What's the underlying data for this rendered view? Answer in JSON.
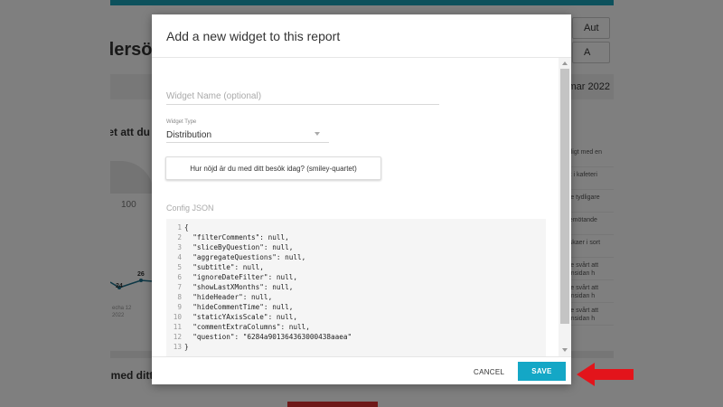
{
  "background": {
    "page_title": "dersö",
    "buttons": [
      "Aut",
      "A"
    ],
    "date_text": "mar 2022",
    "section_1_title": "det att du",
    "gauge_value": "100",
    "chart_points": [
      "24",
      "26"
    ],
    "chart_x_label": "echa 12\n2022",
    "section_2_title": "u med ditt",
    "side_list": [
      "revligt med en",
      "iskt i kafeteri",
      "r lite tydligare",
      "t bemötande",
      "önskaer i sort",
      "r lite svårt att\nhemsidan h",
      "r lite svårt att\nhemsidan h",
      "r lite svårt att\nhemsidan h"
    ],
    "colors": {
      "top_bar": "#1aa3b8"
    }
  },
  "modal": {
    "title": "Add a new widget to this report",
    "widget_name": {
      "value": "",
      "placeholder": "Widget Name (optional)"
    },
    "widget_type": {
      "label": "Widget Type",
      "value": "Distribution"
    },
    "question_chip": "Hur nöjd är du med ditt besök idag? (smiley-quartet)",
    "config_label": "Config JSON",
    "code_lines": [
      "{",
      "  \"filterComments\": null,",
      "  \"sliceByQuestion\": null,",
      "  \"aggregateQuestions\": null,",
      "  \"subtitle\": null,",
      "  \"ignoreDateFilter\": null,",
      "  \"showLastXMonths\": null,",
      "  \"hideHeader\": null,",
      "  \"hideCommentTime\": null,",
      "  \"staticYAxisScale\": null,",
      "  \"commentExtraColumns\": null,",
      "  \"question\": \"6284a901364363000438aaea\"",
      "}"
    ],
    "line_numbers": [
      "1",
      "2",
      "3",
      "4",
      "5",
      "6",
      "7",
      "8",
      "9",
      "10",
      "11",
      "12",
      "13"
    ],
    "cancel_label": "CANCEL",
    "save_label": "SAVE",
    "colors": {
      "save_button": "#14a7c6",
      "arrow": "#e3141b"
    }
  },
  "annotation": {
    "icon": "red-arrow-icon"
  }
}
